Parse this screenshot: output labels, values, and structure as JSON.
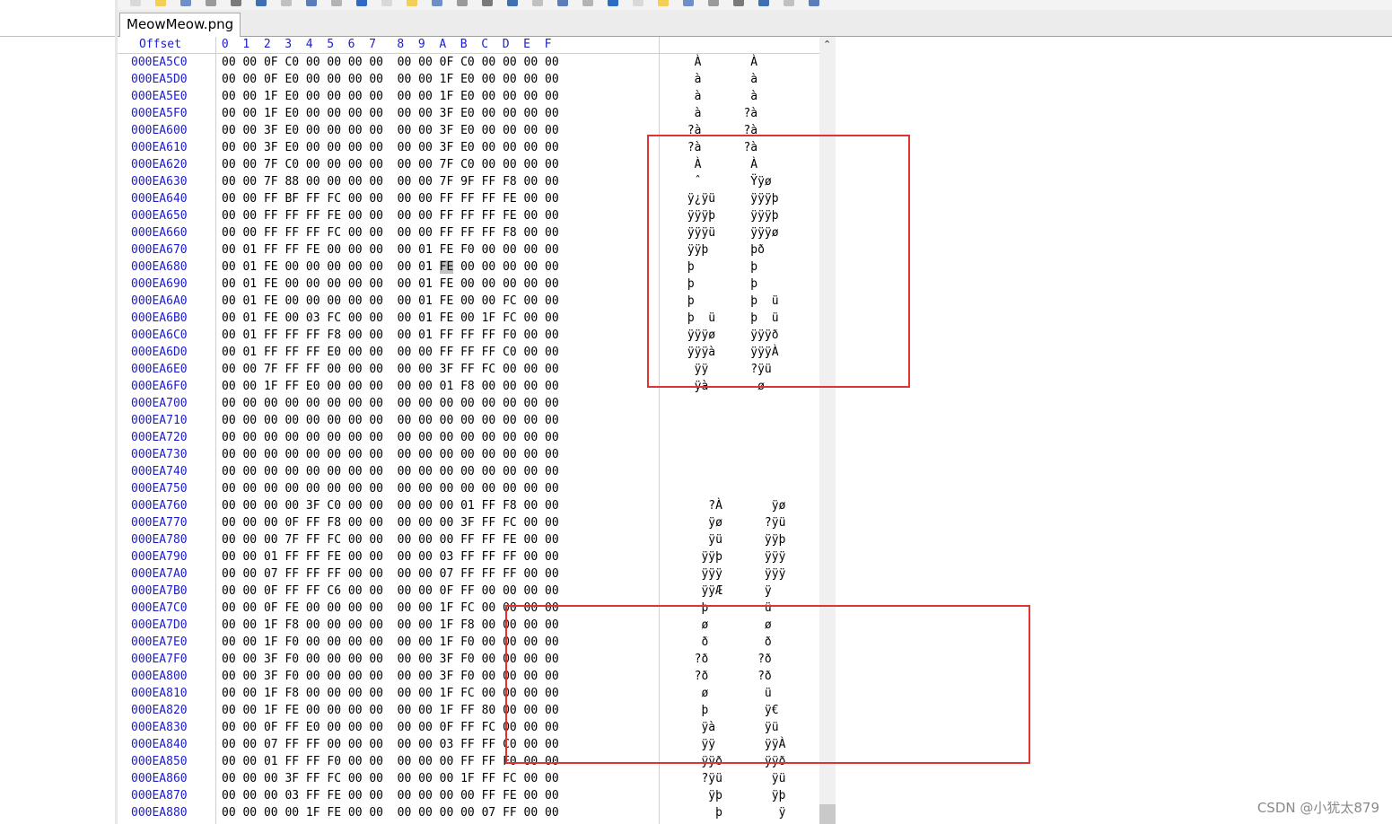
{
  "tab": {
    "title": "MeowMeow.png"
  },
  "header": {
    "offset_label": "Offset",
    "columns": [
      "0",
      "1",
      "2",
      "3",
      "4",
      "5",
      "6",
      "7",
      "8",
      "9",
      "A",
      "B",
      "C",
      "D",
      "E",
      "F"
    ]
  },
  "toolbar_icons": [
    "new-file-icon",
    "open-folder-icon",
    "save-icon",
    "print-icon",
    "properties-icon",
    "open-icon",
    "undo-icon",
    "copy-icon",
    "paste-icon",
    "paste-special-icon",
    "hex-icon",
    "find-icon",
    "find-hex-icon",
    "replace-hex-icon",
    "back-arrow-icon",
    "goto-icon",
    "prev-icon",
    "next-icon",
    "disk-icon",
    "ram-icon",
    "calculator-icon",
    "table-icon",
    "search-icon",
    "options-icon",
    "settings-gear-icon",
    "left-nav-icon",
    "right-nav-icon",
    "book-icon"
  ],
  "rows": [
    {
      "offset": "000EA5C0",
      "hex": "00 00 0F C0 00 00 00 00  00 00 0F C0 00 00 00 00",
      "ascii": "  À       À     "
    },
    {
      "offset": "000EA5D0",
      "hex": "00 00 0F E0 00 00 00 00  00 00 1F E0 00 00 00 00",
      "ascii": "  à       à     "
    },
    {
      "offset": "000EA5E0",
      "hex": "00 00 1F E0 00 00 00 00  00 00 1F E0 00 00 00 00",
      "ascii": "  à       à     "
    },
    {
      "offset": "000EA5F0",
      "hex": "00 00 1F E0 00 00 00 00  00 00 3F E0 00 00 00 00",
      "ascii": "  à      ?à     "
    },
    {
      "offset": "000EA600",
      "hex": "00 00 3F E0 00 00 00 00  00 00 3F E0 00 00 00 00",
      "ascii": " ?à      ?à     "
    },
    {
      "offset": "000EA610",
      "hex": "00 00 3F E0 00 00 00 00  00 00 3F E0 00 00 00 00",
      "ascii": " ?à      ?à     "
    },
    {
      "offset": "000EA620",
      "hex": "00 00 7F C0 00 00 00 00  00 00 7F C0 00 00 00 00",
      "ascii": "  À       À     "
    },
    {
      "offset": "000EA630",
      "hex": "00 00 7F 88 00 00 00 00  00 00 7F 9F FF F8 00 00",
      "ascii": "  ˆ       Ÿÿø   "
    },
    {
      "offset": "000EA640",
      "hex": "00 00 FF BF FF FC 00 00  00 00 FF FF FF FE 00 00",
      "ascii": " ÿ¿ÿü     ÿÿÿþ  "
    },
    {
      "offset": "000EA650",
      "hex": "00 00 FF FF FF FE 00 00  00 00 FF FF FF FE 00 00",
      "ascii": " ÿÿÿþ     ÿÿÿþ  "
    },
    {
      "offset": "000EA660",
      "hex": "00 00 FF FF FF FC 00 00  00 00 FF FF FF F8 00 00",
      "ascii": " ÿÿÿü     ÿÿÿø  "
    },
    {
      "offset": "000EA670",
      "hex": "00 01 FF FF FE 00 00 00  00 01 FE F0 00 00 00 00",
      "ascii": " ÿÿþ      þð    "
    },
    {
      "offset": "000EA680",
      "hex": "00 01 FE 00 00 00 00 00  00 01 FE 00 00 00 00 00",
      "ascii": " þ        þ     "
    },
    {
      "offset": "000EA690",
      "hex": "00 01 FE 00 00 00 00 00  00 01 FE 00 00 00 00 00",
      "ascii": " þ        þ     "
    },
    {
      "offset": "000EA6A0",
      "hex": "00 01 FE 00 00 00 00 00  00 01 FE 00 00 FC 00 00",
      "ascii": " þ        þ  ü  "
    },
    {
      "offset": "000EA6B0",
      "hex": "00 01 FE 00 03 FC 00 00  00 01 FE 00 1F FC 00 00",
      "ascii": " þ  ü     þ  ü  "
    },
    {
      "offset": "000EA6C0",
      "hex": "00 01 FF FF FF F8 00 00  00 01 FF FF FF F0 00 00",
      "ascii": " ÿÿÿø     ÿÿÿð  "
    },
    {
      "offset": "000EA6D0",
      "hex": "00 01 FF FF FF E0 00 00  00 00 FF FF FF C0 00 00",
      "ascii": " ÿÿÿà     ÿÿÿÀ  "
    },
    {
      "offset": "000EA6E0",
      "hex": "00 00 7F FF FF 00 00 00  00 00 3F FF FC 00 00 00",
      "ascii": "  ÿÿ      ?ÿü   "
    },
    {
      "offset": "000EA6F0",
      "hex": "00 00 1F FF E0 00 00 00  00 00 01 F8 00 00 00 00",
      "ascii": "  ÿà       ø    "
    },
    {
      "offset": "000EA700",
      "hex": "00 00 00 00 00 00 00 00  00 00 00 00 00 00 00 00",
      "ascii": ""
    },
    {
      "offset": "000EA710",
      "hex": "00 00 00 00 00 00 00 00  00 00 00 00 00 00 00 00",
      "ascii": ""
    },
    {
      "offset": "000EA720",
      "hex": "00 00 00 00 00 00 00 00  00 00 00 00 00 00 00 00",
      "ascii": ""
    },
    {
      "offset": "000EA730",
      "hex": "00 00 00 00 00 00 00 00  00 00 00 00 00 00 00 00",
      "ascii": ""
    },
    {
      "offset": "000EA740",
      "hex": "00 00 00 00 00 00 00 00  00 00 00 00 00 00 00 00",
      "ascii": ""
    },
    {
      "offset": "000EA750",
      "hex": "00 00 00 00 00 00 00 00  00 00 00 00 00 00 00 00",
      "ascii": ""
    },
    {
      "offset": "000EA760",
      "hex": "00 00 00 00 3F C0 00 00  00 00 00 01 FF F8 00 00",
      "ascii": "    ?À       ÿø  "
    },
    {
      "offset": "000EA770",
      "hex": "00 00 00 0F FF F8 00 00  00 00 00 3F FF FC 00 00",
      "ascii": "    ÿø      ?ÿü  "
    },
    {
      "offset": "000EA780",
      "hex": "00 00 00 7F FF FC 00 00  00 00 00 FF FF FE 00 00",
      "ascii": "    ÿü      ÿÿþ  "
    },
    {
      "offset": "000EA790",
      "hex": "00 00 01 FF FF FE 00 00  00 00 03 FF FF FF 00 00",
      "ascii": "   ÿÿþ      ÿÿÿ  "
    },
    {
      "offset": "000EA7A0",
      "hex": "00 00 07 FF FF FF 00 00  00 00 07 FF FF FF 00 00",
      "ascii": "   ÿÿÿ      ÿÿÿ  "
    },
    {
      "offset": "000EA7B0",
      "hex": "00 00 0F FF FF C6 00 00  00 00 0F FF 00 00 00 00",
      "ascii": "   ÿÿÆ      ÿ    "
    },
    {
      "offset": "000EA7C0",
      "hex": "00 00 0F FE 00 00 00 00  00 00 1F FC 00 00 00 00",
      "ascii": "   þ        ü    "
    },
    {
      "offset": "000EA7D0",
      "hex": "00 00 1F F8 00 00 00 00  00 00 1F F8 00 00 00 00",
      "ascii": "   ø        ø    "
    },
    {
      "offset": "000EA7E0",
      "hex": "00 00 1F F0 00 00 00 00  00 00 1F F0 00 00 00 00",
      "ascii": "   ð        ð    "
    },
    {
      "offset": "000EA7F0",
      "hex": "00 00 3F F0 00 00 00 00  00 00 3F F0 00 00 00 00",
      "ascii": "  ?ð       ?ð    "
    },
    {
      "offset": "000EA800",
      "hex": "00 00 3F F0 00 00 00 00  00 00 3F F0 00 00 00 00",
      "ascii": "  ?ð       ?ð    "
    },
    {
      "offset": "000EA810",
      "hex": "00 00 1F F8 00 00 00 00  00 00 1F FC 00 00 00 00",
      "ascii": "   ø        ü    "
    },
    {
      "offset": "000EA820",
      "hex": "00 00 1F FE 00 00 00 00  00 00 1F FF 80 00 00 00",
      "ascii": "   þ        ÿ€   "
    },
    {
      "offset": "000EA830",
      "hex": "00 00 0F FF E0 00 00 00  00 00 0F FF FC 00 00 00",
      "ascii": "   ÿà       ÿü   "
    },
    {
      "offset": "000EA840",
      "hex": "00 00 07 FF FF 00 00 00  00 00 03 FF FF C0 00 00",
      "ascii": "   ÿÿ       ÿÿÀ  "
    },
    {
      "offset": "000EA850",
      "hex": "00 00 01 FF FF F0 00 00  00 00 00 FF FF F0 00 00",
      "ascii": "   ÿÿð      ÿÿð  "
    },
    {
      "offset": "000EA860",
      "hex": "00 00 00 3F FF FC 00 00  00 00 00 1F FF FC 00 00",
      "ascii": "   ?ÿü       ÿü  "
    },
    {
      "offset": "000EA870",
      "hex": "00 00 00 03 FF FE 00 00  00 00 00 00 FF FE 00 00",
      "ascii": "    ÿþ       ÿþ  "
    },
    {
      "offset": "000EA880",
      "hex": "00 00 00 00 1F FE 00 00  00 00 00 00 07 FF 00 00",
      "ascii": "     þ        ÿ  "
    }
  ],
  "cursor": {
    "row": 12,
    "byte": 10
  },
  "watermark": "CSDN @小犹太879",
  "colors": {
    "offset_text": "#1c1ccc",
    "annotation_box": "#e03434"
  }
}
